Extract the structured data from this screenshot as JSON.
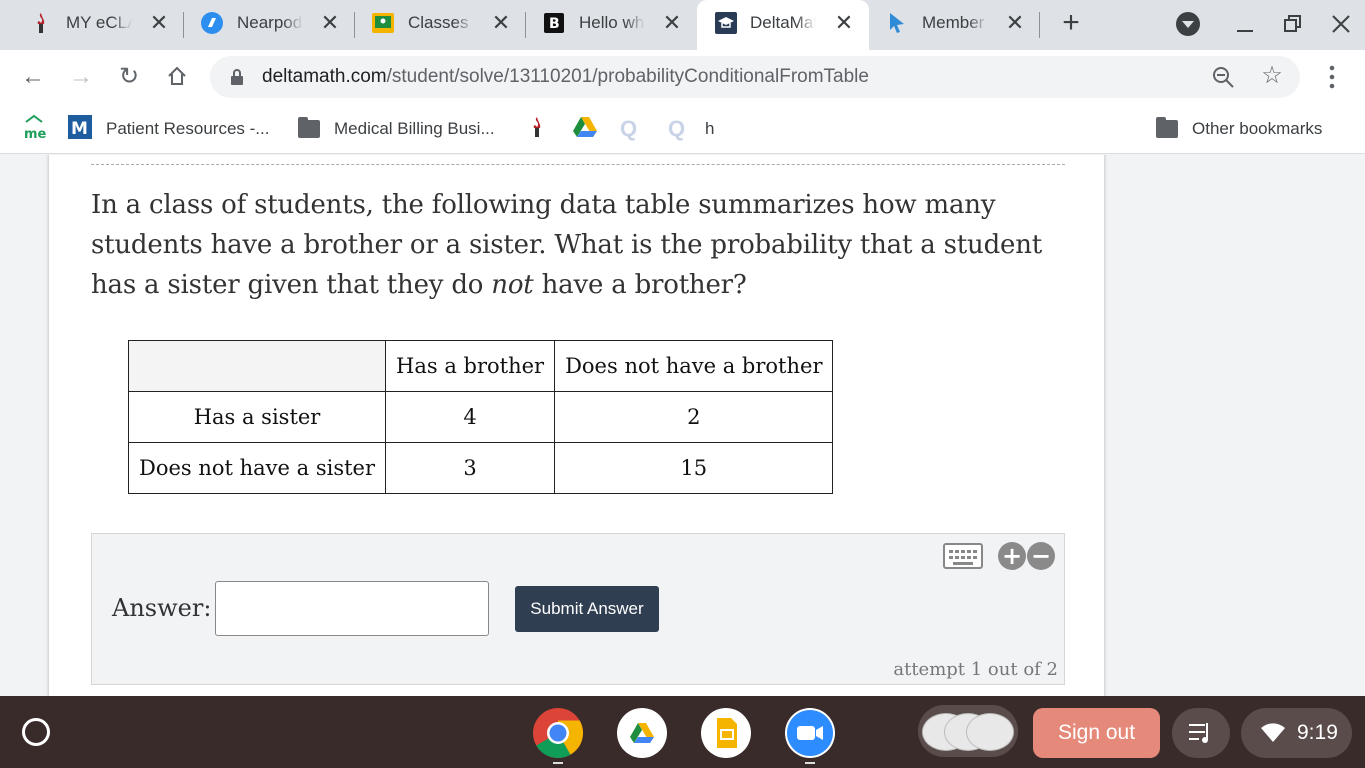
{
  "tabs": [
    {
      "title": "MY eCLASS",
      "icon": "school-torch-icon"
    },
    {
      "title": "Nearpod",
      "icon": "nearpod-icon"
    },
    {
      "title": "Classes",
      "icon": "classroom-icon"
    },
    {
      "title": "Hello who",
      "icon": "brainly-icon"
    },
    {
      "title": "DeltaMath",
      "icon": "graduation-cap-icon"
    },
    {
      "title": "Member Login",
      "icon": "cursor-icon"
    }
  ],
  "address": {
    "host": "deltamath.com",
    "path": "/student/solve/13110201/probabilityConditionalFromTable"
  },
  "bookmarks": [
    {
      "label": "",
      "icon": "me-logo-icon"
    },
    {
      "label": "Patient Resources -...",
      "icon": "m-logo-icon"
    },
    {
      "label": "Medical Billing Busi...",
      "icon": "folder-icon"
    },
    {
      "label": "",
      "icon": "school-torch-icon"
    },
    {
      "label": "",
      "icon": "google-drive-icon"
    },
    {
      "label": "",
      "icon": "q-icon"
    },
    {
      "label": "",
      "icon": "q-icon"
    },
    {
      "label": "h",
      "icon": ""
    },
    {
      "label": "Other bookmarks",
      "icon": "folder-icon"
    }
  ],
  "question": {
    "part1": "In a class of students, the following data table summarizes how many students have a brother or a sister. What is the probability that a student has a sister given that they do ",
    "emphasis": "not",
    "part2": " have a brother?"
  },
  "table": {
    "headers": [
      "",
      "Has a brother",
      "Does not have a brother"
    ],
    "rows": [
      {
        "label": "Has a sister",
        "values": [
          "4",
          "2"
        ]
      },
      {
        "label": "Does not have a sister",
        "values": [
          "3",
          "15"
        ]
      }
    ]
  },
  "answer": {
    "label": "Answer:",
    "value": "",
    "submit_label": "Submit Answer",
    "attempt_text": "attempt 1 out of 2"
  },
  "shelf": {
    "apps": [
      "chrome-icon",
      "google-drive-icon",
      "google-slides-icon",
      "zoom-icon"
    ],
    "signout_label": "Sign out",
    "time": "9:19"
  },
  "colors": {
    "submit_bg": "#2f3e50",
    "signout_bg": "#e5897a",
    "tabstrip_bg": "#dee1e6",
    "shelf_bg": "#3a2b2b"
  }
}
